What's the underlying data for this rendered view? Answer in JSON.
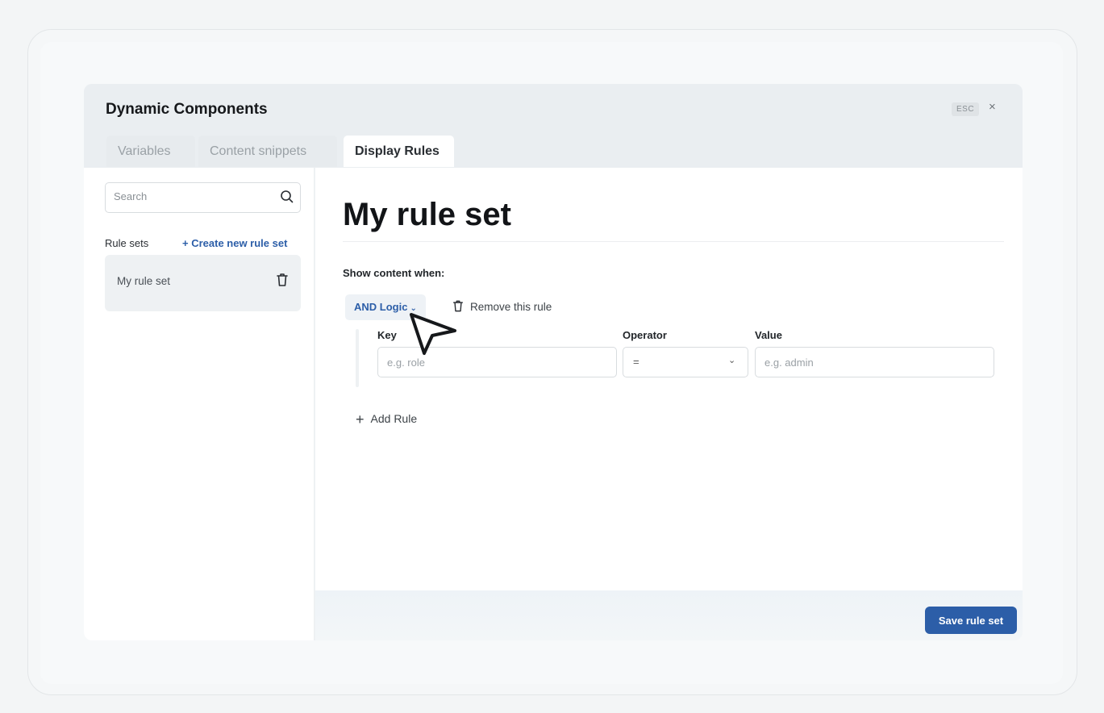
{
  "modal": {
    "title": "Dynamic Components",
    "esc_label": "ESC",
    "close_glyph": "×"
  },
  "tabs": [
    {
      "label": "Variables",
      "active": false
    },
    {
      "label": "Content snippets",
      "active": false
    },
    {
      "label": "Display Rules",
      "active": true
    }
  ],
  "sidebar": {
    "search_placeholder": "Search",
    "rulesets_label": "Rule sets",
    "create_link": "+ Create new rule set",
    "items": [
      {
        "name": "My rule set"
      }
    ]
  },
  "main": {
    "title": "My rule set",
    "show_when": "Show content when:",
    "logic_label": "AND Logic",
    "remove_rule": "Remove this rule",
    "fields": {
      "key_label": "Key",
      "key_placeholder": "e.g. role",
      "operator_label": "Operator",
      "operator_value": "=",
      "value_label": "Value",
      "value_placeholder": "e.g. admin"
    },
    "add_rule": "Add Rule",
    "add_rule_glyph": "+"
  },
  "footer": {
    "save_label": "Save rule set"
  },
  "colors": {
    "accent": "#2c5ea8",
    "background": "#f3f5f6"
  },
  "icons": [
    "search-icon",
    "trash-icon",
    "chevron-down-icon",
    "close-icon",
    "plus-icon",
    "cursor-pointer-icon"
  ]
}
